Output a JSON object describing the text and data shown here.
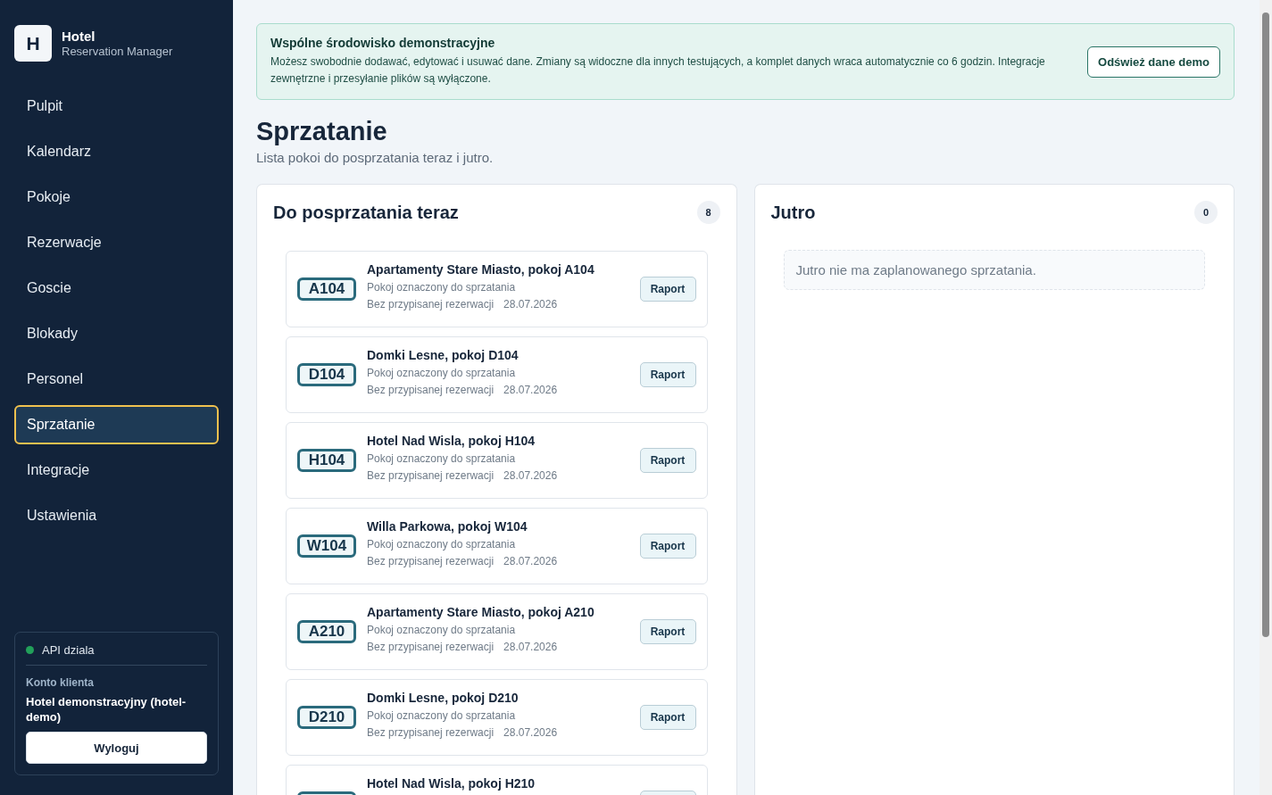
{
  "brand": {
    "logo_letter": "H",
    "title": "Hotel",
    "subtitle": "Reservation Manager"
  },
  "nav": [
    {
      "label": "Pulpit",
      "selected": false
    },
    {
      "label": "Kalendarz",
      "selected": false
    },
    {
      "label": "Pokoje",
      "selected": false
    },
    {
      "label": "Rezerwacje",
      "selected": false
    },
    {
      "label": "Goscie",
      "selected": false
    },
    {
      "label": "Blokady",
      "selected": false
    },
    {
      "label": "Personel",
      "selected": false
    },
    {
      "label": "Sprzatanie",
      "selected": true
    },
    {
      "label": "Integracje",
      "selected": false
    },
    {
      "label": "Ustawienia",
      "selected": false
    }
  ],
  "account": {
    "api_status": "API dziala",
    "label": "Konto klienta",
    "name": "Hotel demonstracyjny (hotel-demo)",
    "logout": "Wyloguj"
  },
  "banner": {
    "title": "Wspólne środowisko demonstracyjne",
    "text": "Możesz swobodnie dodawać, edytować i usuwać dane. Zmiany są widoczne dla innych testujących, a komplet danych wraca automatycznie co 6 godzin. Integracje zewnętrzne i przesyłanie plików są wyłączone.",
    "button": "Odśwież dane demo"
  },
  "page": {
    "title": "Sprzatanie",
    "subtitle": "Lista pokoi do posprzatania teraz i jutro."
  },
  "now": {
    "title": "Do posprzatania teraz",
    "count": "8",
    "items": [
      {
        "code": "A104",
        "title": "Apartamenty Stare Miasto, pokoj A104",
        "status": "Pokoj oznaczony do sprzatania",
        "reservation": "Bez przypisanej rezerwacji",
        "date": "28.07.2026",
        "button": "Raport"
      },
      {
        "code": "D104",
        "title": "Domki Lesne, pokoj D104",
        "status": "Pokoj oznaczony do sprzatania",
        "reservation": "Bez przypisanej rezerwacji",
        "date": "28.07.2026",
        "button": "Raport"
      },
      {
        "code": "H104",
        "title": "Hotel Nad Wisla, pokoj H104",
        "status": "Pokoj oznaczony do sprzatania",
        "reservation": "Bez przypisanej rezerwacji",
        "date": "28.07.2026",
        "button": "Raport"
      },
      {
        "code": "W104",
        "title": "Willa Parkowa, pokoj W104",
        "status": "Pokoj oznaczony do sprzatania",
        "reservation": "Bez przypisanej rezerwacji",
        "date": "28.07.2026",
        "button": "Raport"
      },
      {
        "code": "A210",
        "title": "Apartamenty Stare Miasto, pokoj A210",
        "status": "Pokoj oznaczony do sprzatania",
        "reservation": "Bez przypisanej rezerwacji",
        "date": "28.07.2026",
        "button": "Raport"
      },
      {
        "code": "D210",
        "title": "Domki Lesne, pokoj D210",
        "status": "Pokoj oznaczony do sprzatania",
        "reservation": "Bez przypisanej rezerwacji",
        "date": "28.07.2026",
        "button": "Raport"
      },
      {
        "title": "Hotel Nad Wisla, pokoj H210"
      }
    ]
  },
  "tomorrow": {
    "title": "Jutro",
    "count": "0",
    "empty": "Jutro nie ma zaplanowanego sprzatania."
  }
}
